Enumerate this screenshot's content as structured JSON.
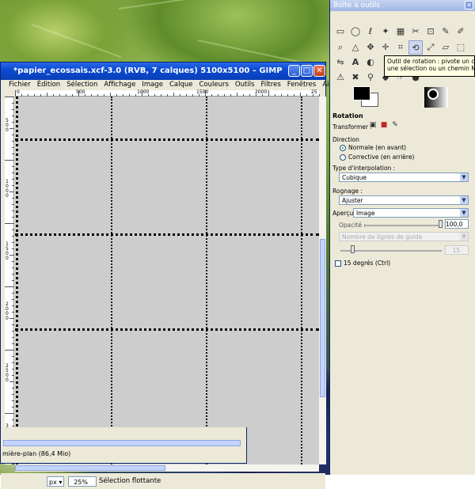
{
  "image_window": {
    "title": "*papier_ecossais.xcf-3.0 (RVB, 7 calques) 5100x5100 – GIMP",
    "menu": [
      "Fichier",
      "Édition",
      "Sélection",
      "Affichage",
      "Image",
      "Calque",
      "Couleurs",
      "Outils",
      "Filtres",
      "Fenêtres",
      "Aide"
    ],
    "ruler_labels": [
      "0",
      "500",
      "1000",
      "1500",
      "2000",
      "25"
    ],
    "vruler_labels": [
      "500",
      "1000",
      "1500",
      "2000",
      "2500",
      "3000"
    ],
    "unit": "px",
    "zoom": "25%",
    "status": "Sélection flottante"
  },
  "lower_window": {
    "status": "mière-plan (86,4 Mio)"
  },
  "toolbox": {
    "title": "Boîte à outils",
    "tooltip_line1": "Outil de rotation : pivote un calq",
    "tooltip_line2": "une sélection ou un chemin  Ma",
    "options_title": "Rotation",
    "transform_label": "Transformer :",
    "direction_label": "Direction",
    "direction_normal": "Normale (en avant)",
    "direction_corrective": "Corrective (en arrière)",
    "interp_label": "Type d'interpolation :",
    "interp_value": "Cubique",
    "clipping_label": "Rognage :",
    "clipping_value": "Ajuster",
    "preview_label": "Aperçu :",
    "preview_value": "Image",
    "opacity_label": "Opacité :",
    "opacity_value": "100,0",
    "guides_value": "Nombre de lignes de guide",
    "guides_count": "15",
    "snap_label": "15 degrés (Ctrl)"
  }
}
